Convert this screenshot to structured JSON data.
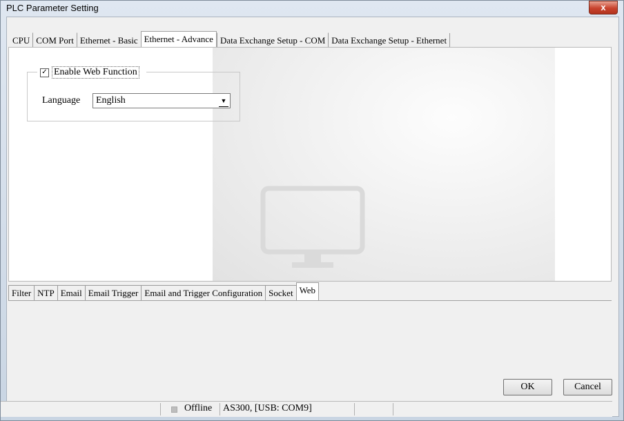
{
  "window": {
    "title": "PLC Parameter Setting",
    "close_label": "x"
  },
  "tabs": [
    {
      "label": "CPU"
    },
    {
      "label": "COM Port"
    },
    {
      "label": "Ethernet - Basic"
    },
    {
      "label": "Ethernet - Advance"
    },
    {
      "label": "Data Exchange Setup - COM"
    },
    {
      "label": "Data Exchange Setup - Ethernet"
    }
  ],
  "active_tab": "Ethernet - Advance",
  "web_panel": {
    "enable_label": "Enable Web Function",
    "enable_checked": true,
    "checkmark": "✓",
    "language_label": "Language",
    "language_value": "English",
    "dropdown_arrow": "▼"
  },
  "subtabs": [
    {
      "label": "Filter"
    },
    {
      "label": "NTP"
    },
    {
      "label": "Email"
    },
    {
      "label": "Email Trigger"
    },
    {
      "label": "Email and Trigger Configuration"
    },
    {
      "label": "Socket"
    },
    {
      "label": "Web"
    }
  ],
  "active_subtab": "Web",
  "buttons": {
    "ok": "OK",
    "cancel": "Cancel"
  },
  "status": {
    "mode": "Offline",
    "device": "AS300, [USB: COM9]"
  },
  "colors": {
    "close_button": "#c8432e",
    "frame": "#c9d5e3",
    "panel": "#f0f0f0"
  },
  "icons": [
    "monitor-icon",
    "close-icon",
    "chevron-down-icon"
  ]
}
